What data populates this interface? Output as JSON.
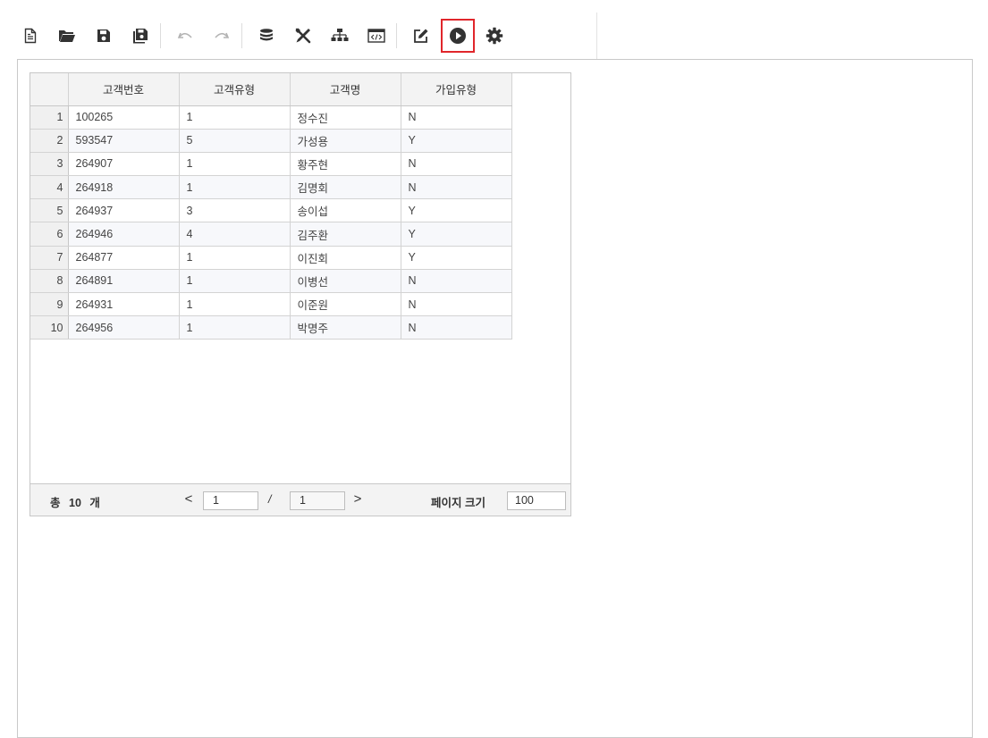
{
  "toolbar": {
    "buttons": [
      {
        "icon": "new-file-icon"
      },
      {
        "icon": "open-folder-icon"
      },
      {
        "icon": "save-icon"
      },
      {
        "icon": "save-as-icon"
      },
      {
        "icon": "undo-icon"
      },
      {
        "icon": "redo-icon"
      },
      {
        "icon": "database-icon"
      },
      {
        "icon": "tools-icon"
      },
      {
        "icon": "hierarchy-icon"
      },
      {
        "icon": "code-view-icon"
      },
      {
        "icon": "edit-icon"
      },
      {
        "icon": "run-icon",
        "highlighted": true
      },
      {
        "icon": "settings-icon"
      }
    ],
    "highlight_color": "#e0262b"
  },
  "grid": {
    "columns": [
      "고객번호",
      "고객유형",
      "고객명",
      "가입유형"
    ],
    "rows": [
      {
        "num": "1",
        "cells": [
          "100265",
          "1",
          "정수진",
          "N"
        ]
      },
      {
        "num": "2",
        "cells": [
          "593547",
          "5",
          "가성용",
          "Y"
        ]
      },
      {
        "num": "3",
        "cells": [
          "264907",
          "1",
          "황주현",
          "N"
        ]
      },
      {
        "num": "4",
        "cells": [
          "264918",
          "1",
          "김명회",
          "N"
        ]
      },
      {
        "num": "5",
        "cells": [
          "264937",
          "3",
          "송이섭",
          "Y"
        ]
      },
      {
        "num": "6",
        "cells": [
          "264946",
          "4",
          "김주환",
          "Y"
        ]
      },
      {
        "num": "7",
        "cells": [
          "264877",
          "1",
          "이진회",
          "Y"
        ]
      },
      {
        "num": "8",
        "cells": [
          "264891",
          "1",
          "이병선",
          "N"
        ]
      },
      {
        "num": "9",
        "cells": [
          "264931",
          "1",
          "이준원",
          "N"
        ]
      },
      {
        "num": "10",
        "cells": [
          "264956",
          "1",
          "박명주",
          "N"
        ]
      }
    ]
  },
  "pager": {
    "total_prefix": "총",
    "total_count": "10",
    "total_unit": "개",
    "prev": "<",
    "current_page": "1",
    "separator": "/",
    "total_pages": "1",
    "next": ">",
    "page_size_label": "페이지 크기",
    "page_size": "100"
  }
}
